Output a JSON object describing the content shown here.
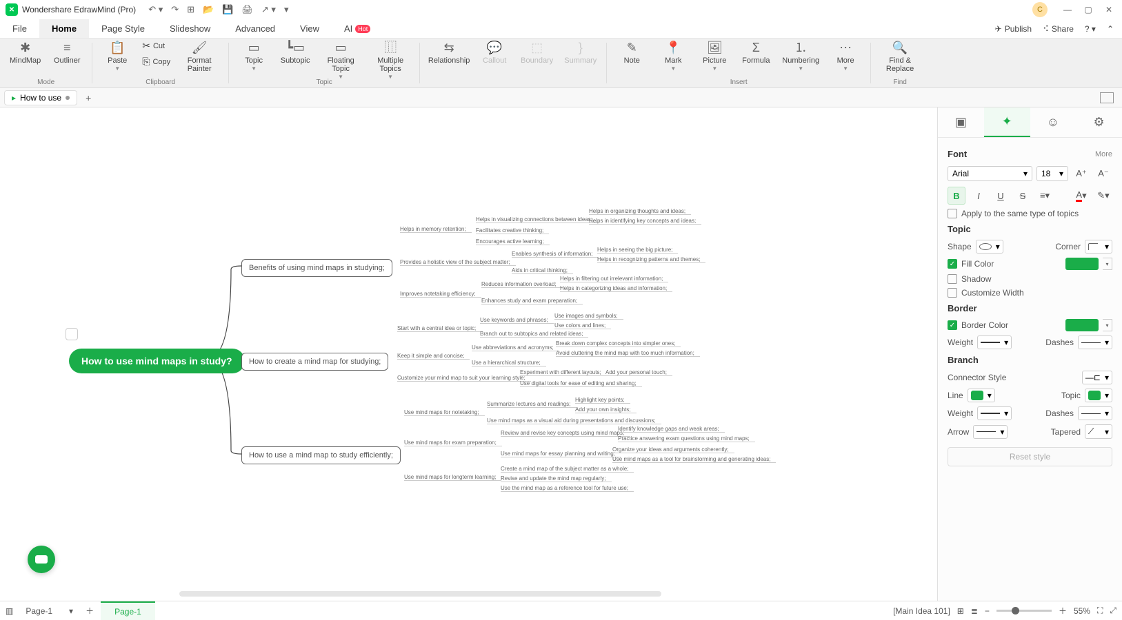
{
  "app": {
    "title": "Wondershare EdrawMind (Pro)",
    "avatar": "C"
  },
  "menus": {
    "file": "File",
    "home": "Home",
    "page_style": "Page Style",
    "slideshow": "Slideshow",
    "advanced": "Advanced",
    "view": "View",
    "ai": "AI",
    "hot": "Hot",
    "publish": "Publish",
    "share": "Share"
  },
  "ribbon": {
    "mode": "Mode",
    "clipboard": "Clipboard",
    "topic": "Topic",
    "insert": "Insert",
    "find": "Find",
    "mindmap": "MindMap",
    "outliner": "Outliner",
    "paste": "Paste",
    "cut": "Cut",
    "copy": "Copy",
    "format_painter": "Format Painter",
    "topic_b": "Topic",
    "subtopic": "Subtopic",
    "floating": "Floating Topic",
    "multiple": "Multiple Topics",
    "relationship": "Relationship",
    "callout": "Callout",
    "boundary": "Boundary",
    "summary": "Summary",
    "note": "Note",
    "mark": "Mark",
    "picture": "Picture",
    "formula": "Formula",
    "numbering": "Numbering",
    "more": "More",
    "find_replace": "Find & Replace"
  },
  "doc": {
    "tab": "How to use",
    "add": "+"
  },
  "map": {
    "root": "How to use mind maps in study?",
    "b1": "Benefits of using mind maps in studying;",
    "b2": "How to create a mind map for studying;",
    "b3": "How to use a mind map to study efficiently;",
    "b1_1": "Helps in memory retention;",
    "b1_2": "Provides a holistic view of the subject matter;",
    "b1_3": "Improves notetaking efficiency;",
    "b1_1a": "Helps in visualizing connections between ideas;",
    "b1_1b": "Facilitates creative thinking;",
    "b1_1c": "Encourages active learning;",
    "b1_1a1": "Helps in organizing thoughts and ideas;",
    "b1_1a2": "Helps in identifying key concepts and ideas;",
    "b1_2a": "Enables synthesis of information;",
    "b1_2b": "Aids in critical thinking;",
    "b1_2a1": "Helps in seeing the big picture;",
    "b1_2a2": "Helps in recognizing patterns and themes;",
    "b1_3a": "Reduces information overload;",
    "b1_3b": "Enhances study and exam preparation;",
    "b1_3a1": "Helps in filtering out irrelevant information;",
    "b1_3a2": "Helps in categorizing ideas and information;",
    "b2_1": "Start with a central idea or topic;",
    "b2_2": "Keep it simple and concise;",
    "b2_3": "Customize your mind map to suit your learning style;",
    "b2_1a": "Use keywords and phrases;",
    "b2_1b": "Branch out to subtopics and related ideas;",
    "b2_1a1": "Use images and symbols;",
    "b2_1a2": "Use colors and lines;",
    "b2_2a": "Use abbreviations and acronyms;",
    "b2_2b": "Use a hierarchical structure;",
    "b2_2a1": "Break down complex concepts into simpler ones;",
    "b2_2a2": "Avoid cluttering the mind map with too much information;",
    "b2_3a": "Experiment with different layouts;",
    "b2_3b": "Use digital tools for ease of editing and sharing;",
    "b2_3a1": "Add your personal touch;",
    "b3_1": "Use mind maps for notetaking;",
    "b3_2": "Use mind maps for exam preparation;",
    "b3_3": "Use mind maps for longterm learning;",
    "b3_1a": "Summarize lectures and readings;",
    "b3_1b": "Use mind maps as a visual aid during presentations and discussions;",
    "b3_1a1": "Highlight key points;",
    "b3_1a2": "Add your own insights;",
    "b3_2a": "Review and revise key concepts using mind maps;",
    "b3_2b": "Use mind maps for essay planning and writing;",
    "b3_2a1": "Identify knowledge gaps and weak areas;",
    "b3_2a2": "Practice answering exam questions using mind maps;",
    "b3_2b1": "Organize your ideas and arguments coherently;",
    "b3_2b2": "Use mind maps as a tool for brainstorming and generating ideas;",
    "b3_3a": "Create a mind map of the subject matter as a whole;",
    "b3_3b": "Revise and update the mind map regularly;",
    "b3_3c": "Use the mind map as a reference tool for future use;"
  },
  "panel": {
    "font": "Font",
    "more": "More",
    "font_family": "Arial",
    "font_size": "18",
    "apply_same": "Apply to the same type of topics",
    "topic": "Topic",
    "shape": "Shape",
    "corner": "Corner",
    "fill_color": "Fill Color",
    "shadow": "Shadow",
    "customize_width": "Customize Width",
    "border": "Border",
    "border_color": "Border Color",
    "weight": "Weight",
    "dashes": "Dashes",
    "branch": "Branch",
    "connector_style": "Connector Style",
    "line": "Line",
    "topic_c": "Topic",
    "arrow": "Arrow",
    "tapered": "Tapered",
    "reset": "Reset style"
  },
  "status": {
    "page_dd": "Page-1",
    "page_active": "Page-1",
    "context": "[Main Idea 101]",
    "zoom": "55%"
  }
}
